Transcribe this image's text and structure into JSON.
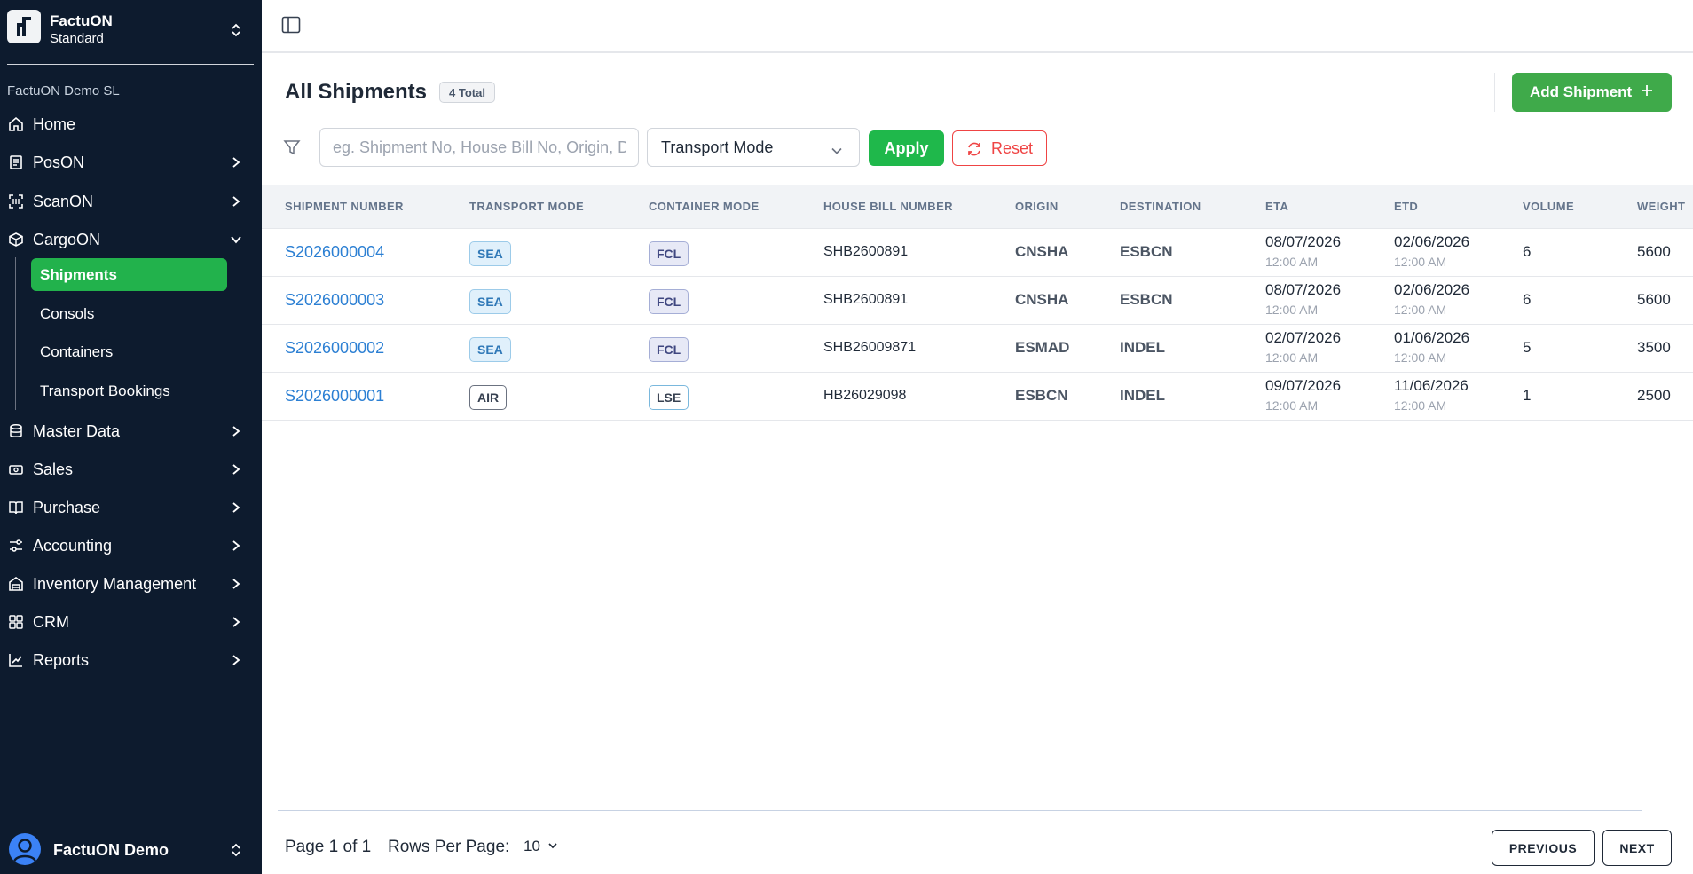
{
  "sidebar": {
    "brand": {
      "name": "FactuON",
      "plan": "Standard"
    },
    "org_name": "FactuON Demo SL",
    "nav": [
      {
        "label": "Home",
        "icon": "home-icon",
        "chevron": ""
      },
      {
        "label": "PosON",
        "icon": "receipt-icon",
        "chevron": "right"
      },
      {
        "label": "ScanON",
        "icon": "scan-icon",
        "chevron": "right"
      },
      {
        "label": "CargoON",
        "icon": "package-icon",
        "chevron": "down"
      },
      {
        "label": "Master Data",
        "icon": "database-icon",
        "chevron": "right"
      },
      {
        "label": "Sales",
        "icon": "banknote-icon",
        "chevron": "right"
      },
      {
        "label": "Purchase",
        "icon": "book-icon",
        "chevron": "right"
      },
      {
        "label": "Accounting",
        "icon": "sliders-icon",
        "chevron": "right"
      },
      {
        "label": "Inventory Management",
        "icon": "warehouse-icon",
        "chevron": "right"
      },
      {
        "label": "CRM",
        "icon": "grid-icon",
        "chevron": "right"
      },
      {
        "label": "Reports",
        "icon": "chart-line-icon",
        "chevron": "right"
      }
    ],
    "cargo_sub": [
      {
        "label": "Shipments",
        "active": true
      },
      {
        "label": "Consols",
        "active": false
      },
      {
        "label": "Containers",
        "active": false
      },
      {
        "label": "Transport Bookings",
        "active": false
      }
    ],
    "user": {
      "name": "FactuON Demo"
    }
  },
  "header": {
    "title": "All Shipments",
    "total_badge": "4 Total",
    "add_button": "Add Shipment"
  },
  "filters": {
    "search_placeholder": "eg. Shipment No, House Bill No, Origin, Destination",
    "transport_mode": "Transport Mode",
    "apply": "Apply",
    "reset": "Reset"
  },
  "table": {
    "columns": [
      "SHIPMENT NUMBER",
      "TRANSPORT MODE",
      "CONTAINER MODE",
      "HOUSE BILL NUMBER",
      "ORIGIN",
      "DESTINATION",
      "ETA",
      "ETD",
      "VOLUME",
      "WEIGHT"
    ],
    "rows": [
      {
        "shipment": "S2026000004",
        "transport": "SEA",
        "container": "FCL",
        "hbl": "SHB2600891",
        "origin": "CNSHA",
        "destination": "ESBCN",
        "eta_date": "08/07/2026",
        "eta_time": "12:00 AM",
        "etd_date": "02/06/2026",
        "etd_time": "12:00 AM",
        "volume": "6",
        "weight": "5600"
      },
      {
        "shipment": "S2026000003",
        "transport": "SEA",
        "container": "FCL",
        "hbl": "SHB2600891",
        "origin": "CNSHA",
        "destination": "ESBCN",
        "eta_date": "08/07/2026",
        "eta_time": "12:00 AM",
        "etd_date": "02/06/2026",
        "etd_time": "12:00 AM",
        "volume": "6",
        "weight": "5600"
      },
      {
        "shipment": "S2026000002",
        "transport": "SEA",
        "container": "FCL",
        "hbl": "SHB26009871",
        "origin": "ESMAD",
        "destination": "INDEL",
        "eta_date": "02/07/2026",
        "eta_time": "12:00 AM",
        "etd_date": "01/06/2026",
        "etd_time": "12:00 AM",
        "volume": "5",
        "weight": "3500"
      },
      {
        "shipment": "S2026000001",
        "transport": "AIR",
        "container": "LSE",
        "hbl": "HB26029098",
        "origin": "ESBCN",
        "destination": "INDEL",
        "eta_date": "09/07/2026",
        "eta_time": "12:00 AM",
        "etd_date": "11/06/2026",
        "etd_time": "12:00 AM",
        "volume": "1",
        "weight": "2500"
      }
    ]
  },
  "footer": {
    "page_info": "Page 1 of 1",
    "rows_label": "Rows Per Page:",
    "rows_value": "10",
    "previous": "PREVIOUS",
    "next": "NEXT"
  },
  "colors": {
    "sidebar_bg": "#0d1b2e",
    "accent_green": "#22b24c",
    "link_blue": "#2b7fd3",
    "reset_red": "#ef4444"
  }
}
